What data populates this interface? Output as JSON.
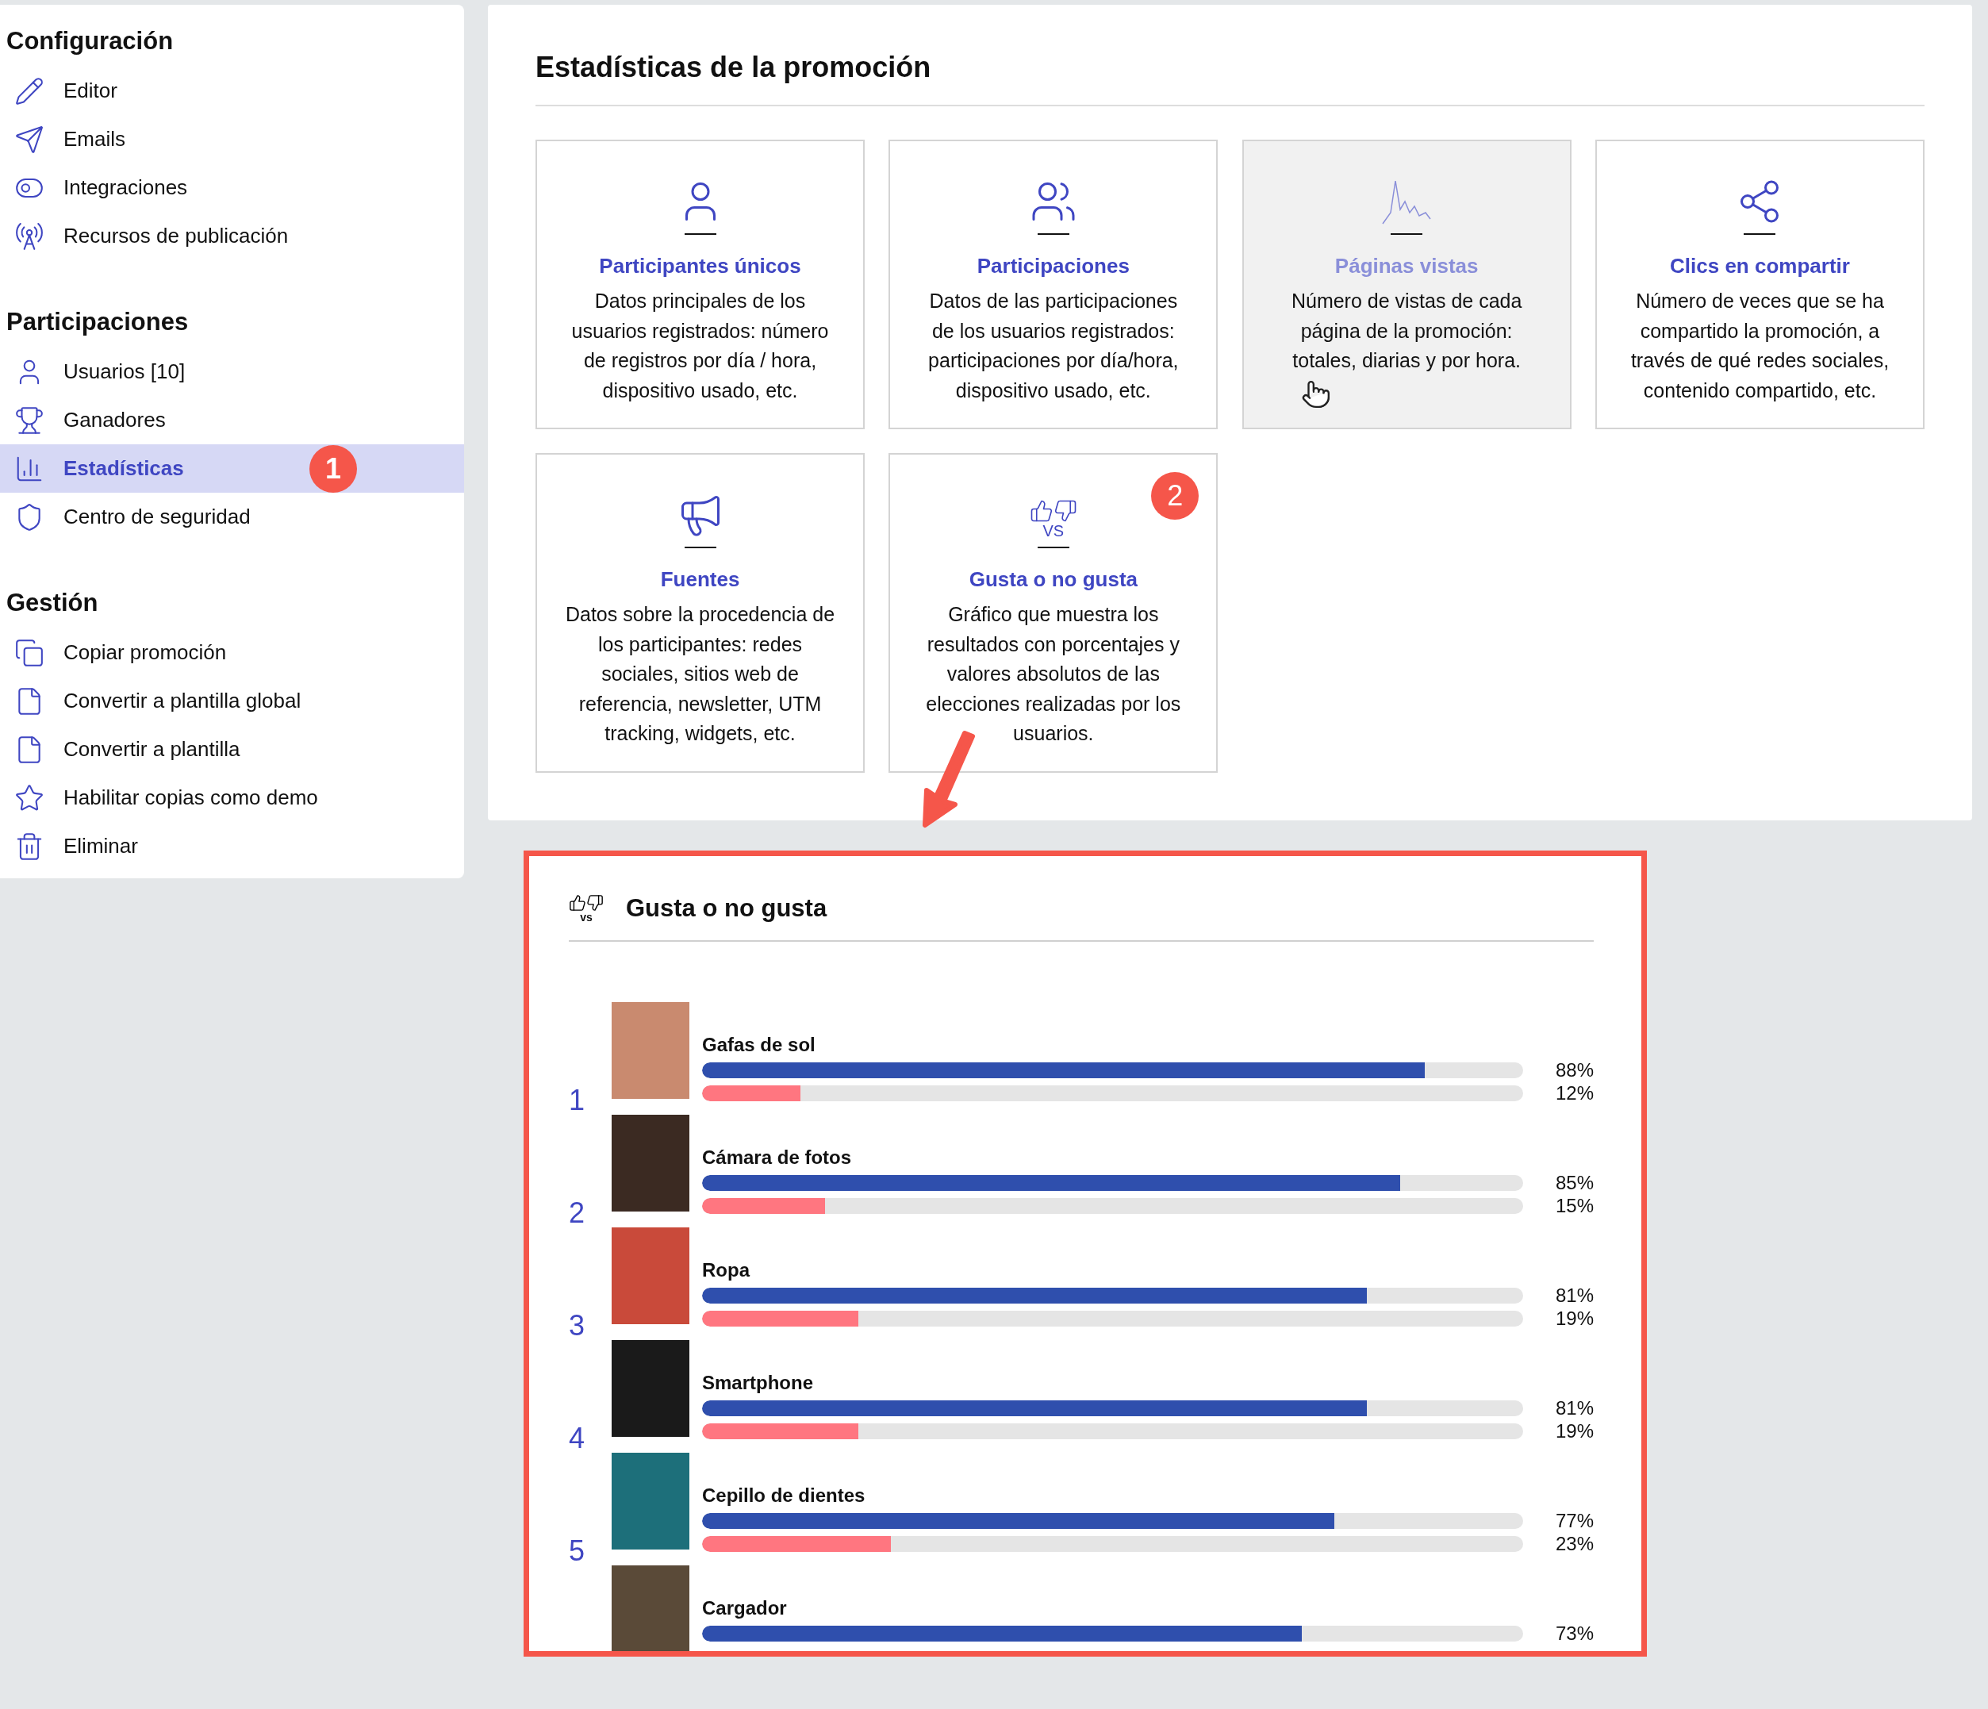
{
  "sidebar": {
    "sections": [
      {
        "title": "Configuración",
        "items": [
          {
            "label": "Editor",
            "selected": false
          },
          {
            "label": "Emails",
            "selected": false
          },
          {
            "label": "Integraciones",
            "selected": false
          },
          {
            "label": "Recursos de publicación",
            "selected": false
          }
        ]
      },
      {
        "title": "Participaciones",
        "items": [
          {
            "label": "Usuarios [10]",
            "selected": false
          },
          {
            "label": "Ganadores",
            "selected": false
          },
          {
            "label": "Estadísticas",
            "selected": true,
            "badge": "1"
          },
          {
            "label": "Centro de seguridad",
            "selected": false
          }
        ]
      },
      {
        "title": "Gestión",
        "items": [
          {
            "label": "Copiar promoción",
            "selected": false
          },
          {
            "label": "Convertir a plantilla global",
            "selected": false
          },
          {
            "label": "Convertir a plantilla",
            "selected": false
          },
          {
            "label": "Habilitar copias como demo",
            "selected": false
          },
          {
            "label": "Eliminar",
            "selected": false
          }
        ]
      }
    ]
  },
  "main": {
    "title": "Estadísticas de la promoción",
    "cards": [
      {
        "title": "Participantes únicos",
        "description": "Datos principales de los usuarios registrados: número de registros por día / hora, dispositivo usado, etc.",
        "hovered": false
      },
      {
        "title": "Participaciones",
        "description": "Datos de las participaciones de los usuarios registrados: participaciones por día/hora, dispositivo usado, etc.",
        "hovered": false
      },
      {
        "title": "Páginas vistas",
        "description": "Número de vistas de cada página de la promoción: totales, diarias y por hora.",
        "hovered": true
      },
      {
        "title": "Clics en compartir",
        "description": "Número de veces que se ha compartido la promoción, a través de qué redes sociales, contenido compartido, etc.",
        "hovered": false
      },
      {
        "title": "Fuentes",
        "description": "Datos sobre la procedencia de los participantes: redes sociales, sitios web de referencia, newsletter, UTM tracking, widgets, etc.",
        "hovered": false
      },
      {
        "title": "Gusta o no gusta",
        "description": "Gráfico que muestra los resultados con porcentajes y valores absolutos de las elecciones realizadas por los usuarios.",
        "hovered": false,
        "icon_label": "VS",
        "badge": "2"
      }
    ]
  },
  "detail": {
    "title": "Gusta o no gusta",
    "icon_label": "vs",
    "items": [
      {
        "rank": "1",
        "name": "Gafas de sol",
        "bars": [
          {
            "kind": "like",
            "level": 0.88,
            "reading": "88%"
          },
          {
            "kind": "dislike",
            "level": 0.12,
            "reading": "12%"
          }
        ]
      },
      {
        "rank": "2",
        "name": "Cámara de fotos",
        "bars": [
          {
            "kind": "like",
            "level": 0.85,
            "reading": "85%"
          },
          {
            "kind": "dislike",
            "level": 0.15,
            "reading": "15%"
          }
        ]
      },
      {
        "rank": "3",
        "name": "Ropa",
        "bars": [
          {
            "kind": "like",
            "level": 0.81,
            "reading": "81%"
          },
          {
            "kind": "dislike",
            "level": 0.19,
            "reading": "19%"
          }
        ]
      },
      {
        "rank": "4",
        "name": "Smartphone",
        "bars": [
          {
            "kind": "like",
            "level": 0.81,
            "reading": "81%"
          },
          {
            "kind": "dislike",
            "level": 0.19,
            "reading": "19%"
          }
        ]
      },
      {
        "rank": "5",
        "name": "Cepillo de dientes",
        "bars": [
          {
            "kind": "like",
            "level": 0.77,
            "reading": "77%"
          },
          {
            "kind": "dislike",
            "level": 0.23,
            "reading": "23%"
          }
        ]
      },
      {
        "name": "Cargador",
        "bars": [
          {
            "kind": "like",
            "level": 0.73,
            "reading": "73%"
          }
        ]
      }
    ]
  }
}
